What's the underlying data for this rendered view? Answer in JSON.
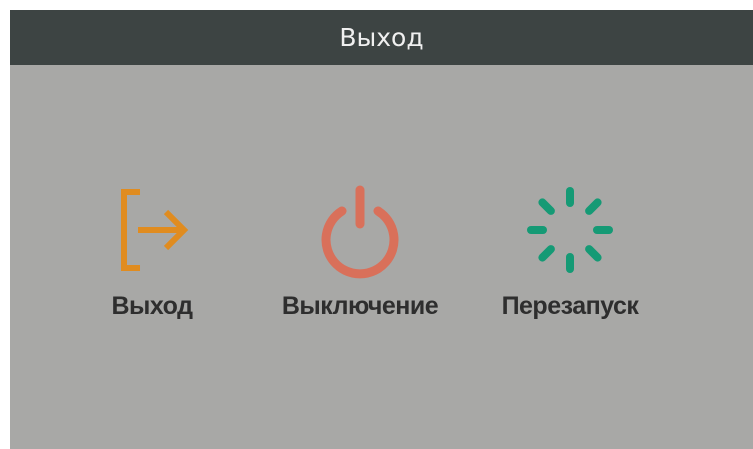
{
  "dialog": {
    "title": "Выход"
  },
  "options": [
    {
      "label": "Выход",
      "icon": "exit-icon",
      "color": "#e08c20"
    },
    {
      "label": "Выключение",
      "icon": "power-icon",
      "color": "#d9705a"
    },
    {
      "label": "Перезапуск",
      "icon": "restart-spinner-icon",
      "color": "#159a75"
    }
  ],
  "colors": {
    "titlebar": "#3d4443",
    "background": "#a8a8a6",
    "label_text": "#2e2e2e"
  }
}
